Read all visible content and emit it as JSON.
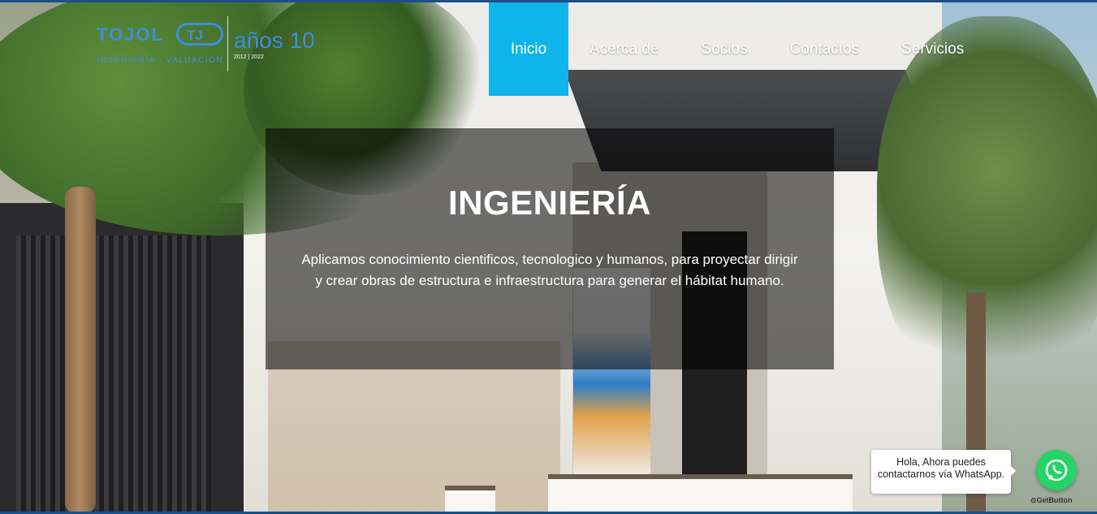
{
  "logo": {
    "brand": "TOJOL",
    "tagline": "INGENIERÍA · VALUACIÓN",
    "anniversary_text": "años",
    "anniversary_number": "10",
    "years": "2012 | 2022",
    "color": "#3b8fdc"
  },
  "nav": {
    "items": [
      {
        "label": "Inicio",
        "active": true
      },
      {
        "label": "Acerca de",
        "active": false
      },
      {
        "label": "Socios",
        "active": false
      },
      {
        "label": "Contactos",
        "active": false
      },
      {
        "label": "Servicios",
        "active": false
      }
    ],
    "active_color": "#0fb4ea"
  },
  "hero": {
    "title": "INGENIERÍA",
    "description": "Aplicamos conocimiento cientificos, tecnologico y humanos, para proyectar dirigir y crear obras de estructura e infraestructura para generar el hábitat humano."
  },
  "whatsapp": {
    "message": "Hola, Ahora puedes contactarnos vía WhatsApp.",
    "credit": "GetButton",
    "icon": "whatsapp-icon",
    "color": "#25d366"
  }
}
